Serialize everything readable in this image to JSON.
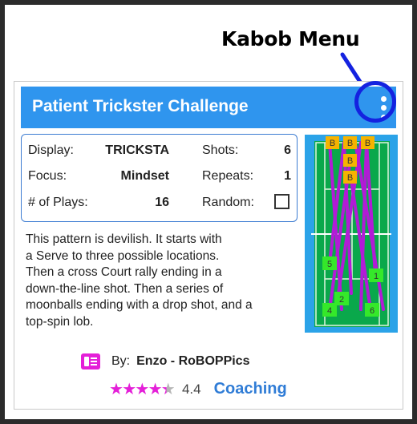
{
  "annotation": {
    "label": "Kabob Menu"
  },
  "card": {
    "title": "Patient Trickster Challenge",
    "stats": {
      "display_label": "Display:",
      "display_value": "TRICKSTA",
      "focus_label": "Focus:",
      "focus_value": "Mindset",
      "plays_label": "# of Plays:",
      "plays_value": "16",
      "shots_label": "Shots:",
      "shots_value": "6",
      "repeats_label": "Repeats:",
      "repeats_value": "1",
      "random_label": "Random:",
      "random_checked": false
    },
    "description_lines": [
      "This pattern is devilish. It starts with",
      "a Serve to three possible locations.",
      "Then a cross Court rally ending in a",
      "down-the-line shot. Then a series of",
      "moonballs ending with a drop shot, and a",
      "top-spin lob."
    ],
    "court": {
      "top_markers": [
        "B",
        "B",
        "B",
        "B",
        "B"
      ],
      "bottom_markers": [
        "5",
        "1",
        "2",
        "4",
        "6"
      ]
    },
    "author": {
      "by_label": "By:",
      "name": "Enzo - RoBOPPics"
    },
    "rating": {
      "value": "4.4",
      "stars": 4.4,
      "max": 5
    },
    "category": "Coaching"
  },
  "colors": {
    "header": "#2f95ee",
    "kabob_highlight": "#1422e0",
    "star": "#e41fd8",
    "court_green": "#0aa84b",
    "court_border": "#2ba3e8",
    "shot_line": "#b21bd6",
    "marker_orange": "#f6b300",
    "marker_green": "#35e82a"
  }
}
